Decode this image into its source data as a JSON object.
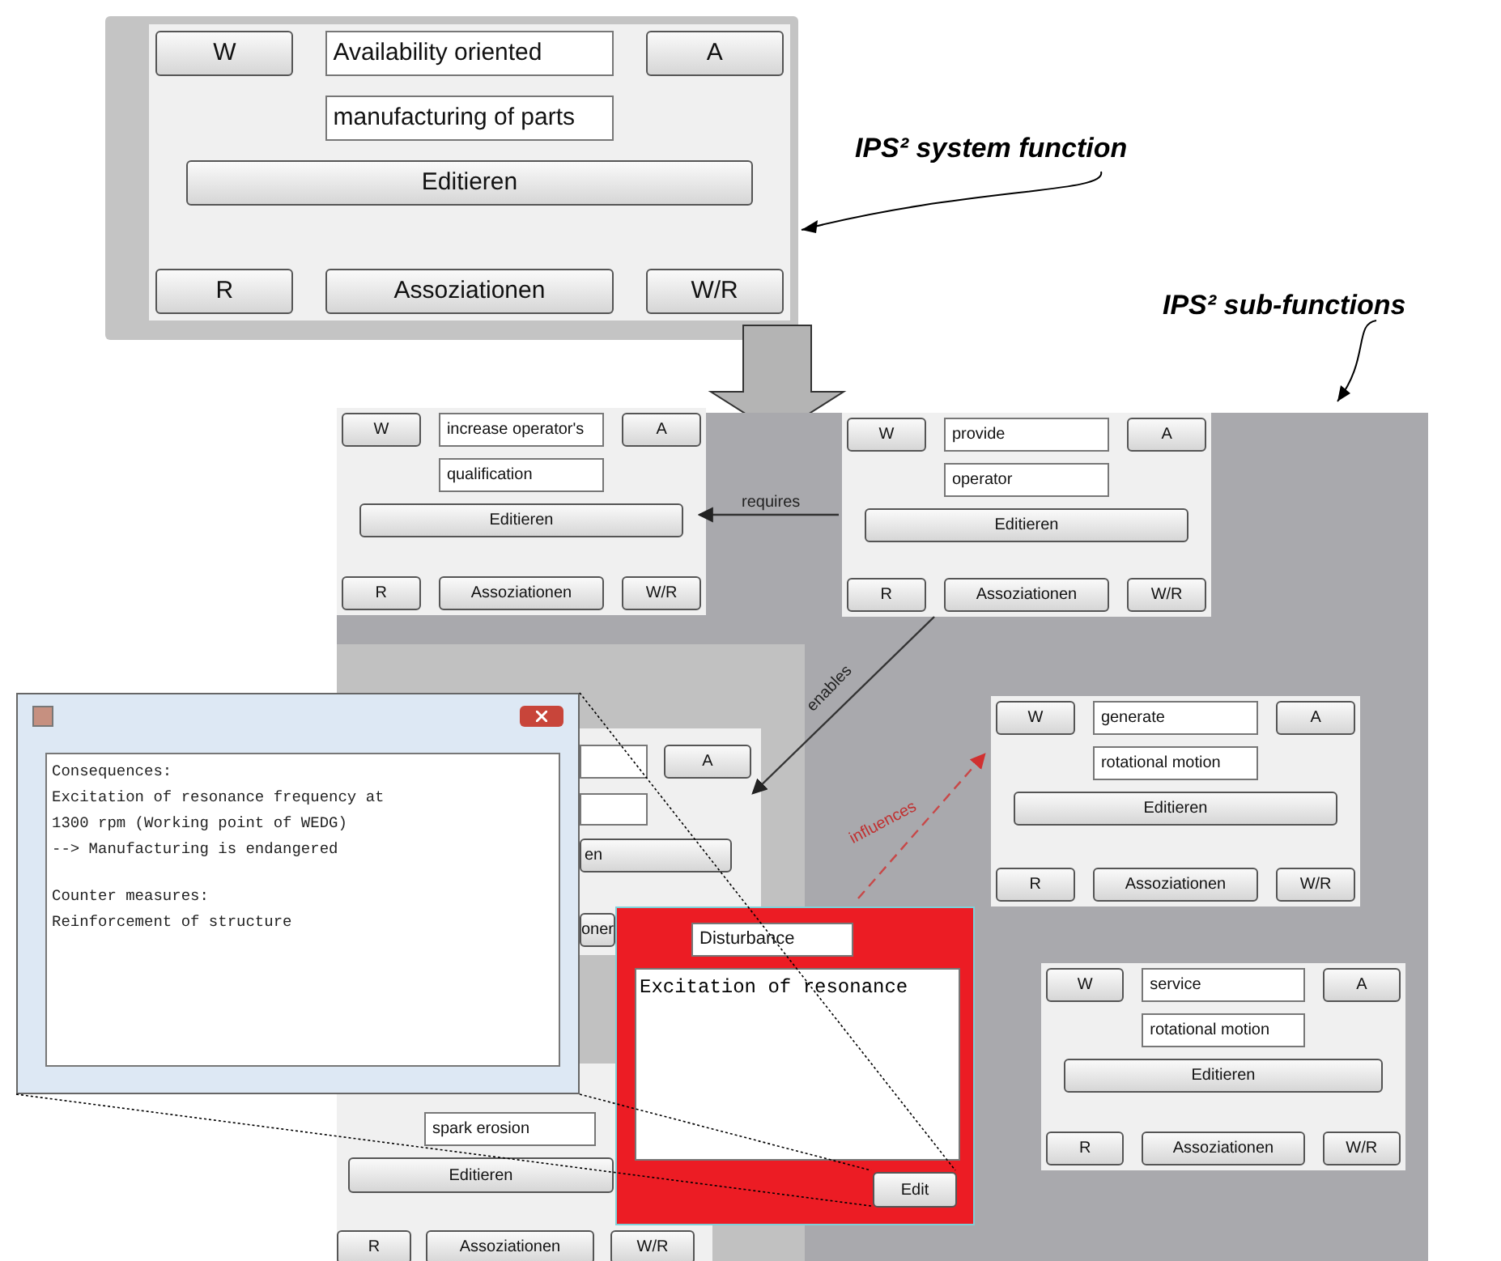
{
  "system_function": {
    "kind": "full",
    "w": "W",
    "title": "Availability oriented",
    "a": "A",
    "subtitle": "manufacturing of parts",
    "edit": "Editieren",
    "r": "R",
    "assoc": "Assoziationen",
    "wr": "W/R"
  },
  "annotations": [
    {
      "text": "IPS² system function"
    },
    {
      "text": "IPS² sub-functions"
    }
  ],
  "nodes": [
    {
      "kind": "full",
      "w": "W",
      "title": "increase operator's",
      "a": "A",
      "subtitle": "qualification",
      "edit": "Editieren",
      "r": "R",
      "assoc": "Assoziationen",
      "wr": "W/R"
    },
    {
      "kind": "full",
      "w": "W",
      "title": "provide",
      "a": "A",
      "subtitle": "operator",
      "edit": "Editieren",
      "r": "R",
      "assoc": "Assoziationen",
      "wr": "W/R"
    },
    {
      "kind": "full",
      "w": "W",
      "title": "generate",
      "a": "A",
      "subtitle": "rotational motion",
      "edit": "Editieren",
      "r": "R",
      "assoc": "Assoziationen",
      "wr": "W/R"
    },
    {
      "kind": "full",
      "w": "W",
      "title": "service",
      "a": "A",
      "subtitle": "rotational motion",
      "edit": "Editieren",
      "r": "R",
      "assoc": "Assoziationen",
      "wr": "W/R"
    },
    {
      "kind": "covered",
      "a": "A",
      "edit": "en",
      "assoc": "oner"
    },
    {
      "kind": "lower",
      "subtitle": "spark erosion",
      "edit": "Editieren",
      "r": "R",
      "assoc": "Assoziationen",
      "wr": "W/R"
    }
  ],
  "relations": [
    {
      "label": "requires",
      "kind": "solid"
    },
    {
      "label": "enables",
      "kind": "solid"
    },
    {
      "label": "influences",
      "kind": "dashed"
    }
  ],
  "popup": {
    "paragraphs": [
      [
        "Consequences:",
        "Excitation of resonance frequency at",
        "1300 rpm (Working point of WEDG)",
        "--> Manufacturing is endangered"
      ],
      [
        "Counter measures:",
        "Reinforcement of structure"
      ]
    ]
  },
  "disturbance": {
    "title": "Disturbance",
    "text": "Excitation of resonance",
    "button": "Edit"
  }
}
